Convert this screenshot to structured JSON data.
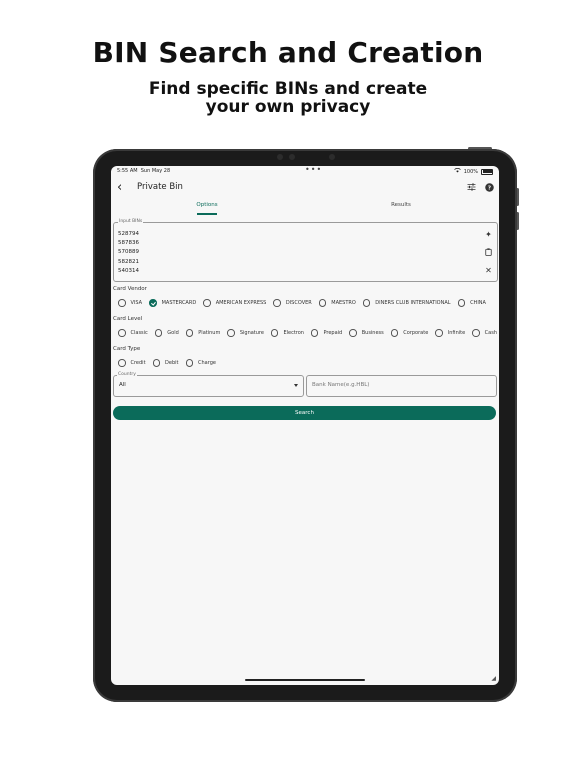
{
  "headline": "BIN Search and Creation",
  "subheadline": "Find specific BINs and create your own privacy",
  "status_bar": {
    "time": "5:55 AM",
    "date": "Sun May 28",
    "battery": "100%"
  },
  "app": {
    "title": "Private Bin",
    "icons": {
      "back": "chevron-left-icon",
      "filter": "sliders-icon",
      "help": "help-circle-icon"
    }
  },
  "tabs": [
    {
      "label": "Options",
      "active": true
    },
    {
      "label": "Results",
      "active": false
    }
  ],
  "input_bins": {
    "label": "Input BINs",
    "lines": [
      "528794",
      "587836",
      "570889",
      "582821",
      "540314"
    ],
    "icons": [
      "sparkle-icon",
      "clipboard-icon",
      "close-icon"
    ]
  },
  "card_vendor": {
    "label": "Card Vendor",
    "options": [
      "VISA",
      "MASTERCARD",
      "AMERICAN EXPRESS",
      "DISCOVER",
      "MAESTRO",
      "DINERS CLUB INTERNATIONAL",
      "CHINA"
    ],
    "selected": "MASTERCARD"
  },
  "card_level": {
    "label": "Card Level",
    "options": [
      "Classic",
      "Gold",
      "Platinum",
      "Signature",
      "Electron",
      "Prepaid",
      "Business",
      "Corporate",
      "Infinite",
      "Cash"
    ]
  },
  "card_type": {
    "label": "Card Type",
    "options": [
      "Credit",
      "Debit",
      "Charge"
    ]
  },
  "country": {
    "label": "Country",
    "value": "All"
  },
  "bank_name": {
    "placeholder": "Bank Name(e.g.HBL)"
  },
  "search_label": "Search",
  "colors": {
    "accent": "#0b6b5a"
  }
}
